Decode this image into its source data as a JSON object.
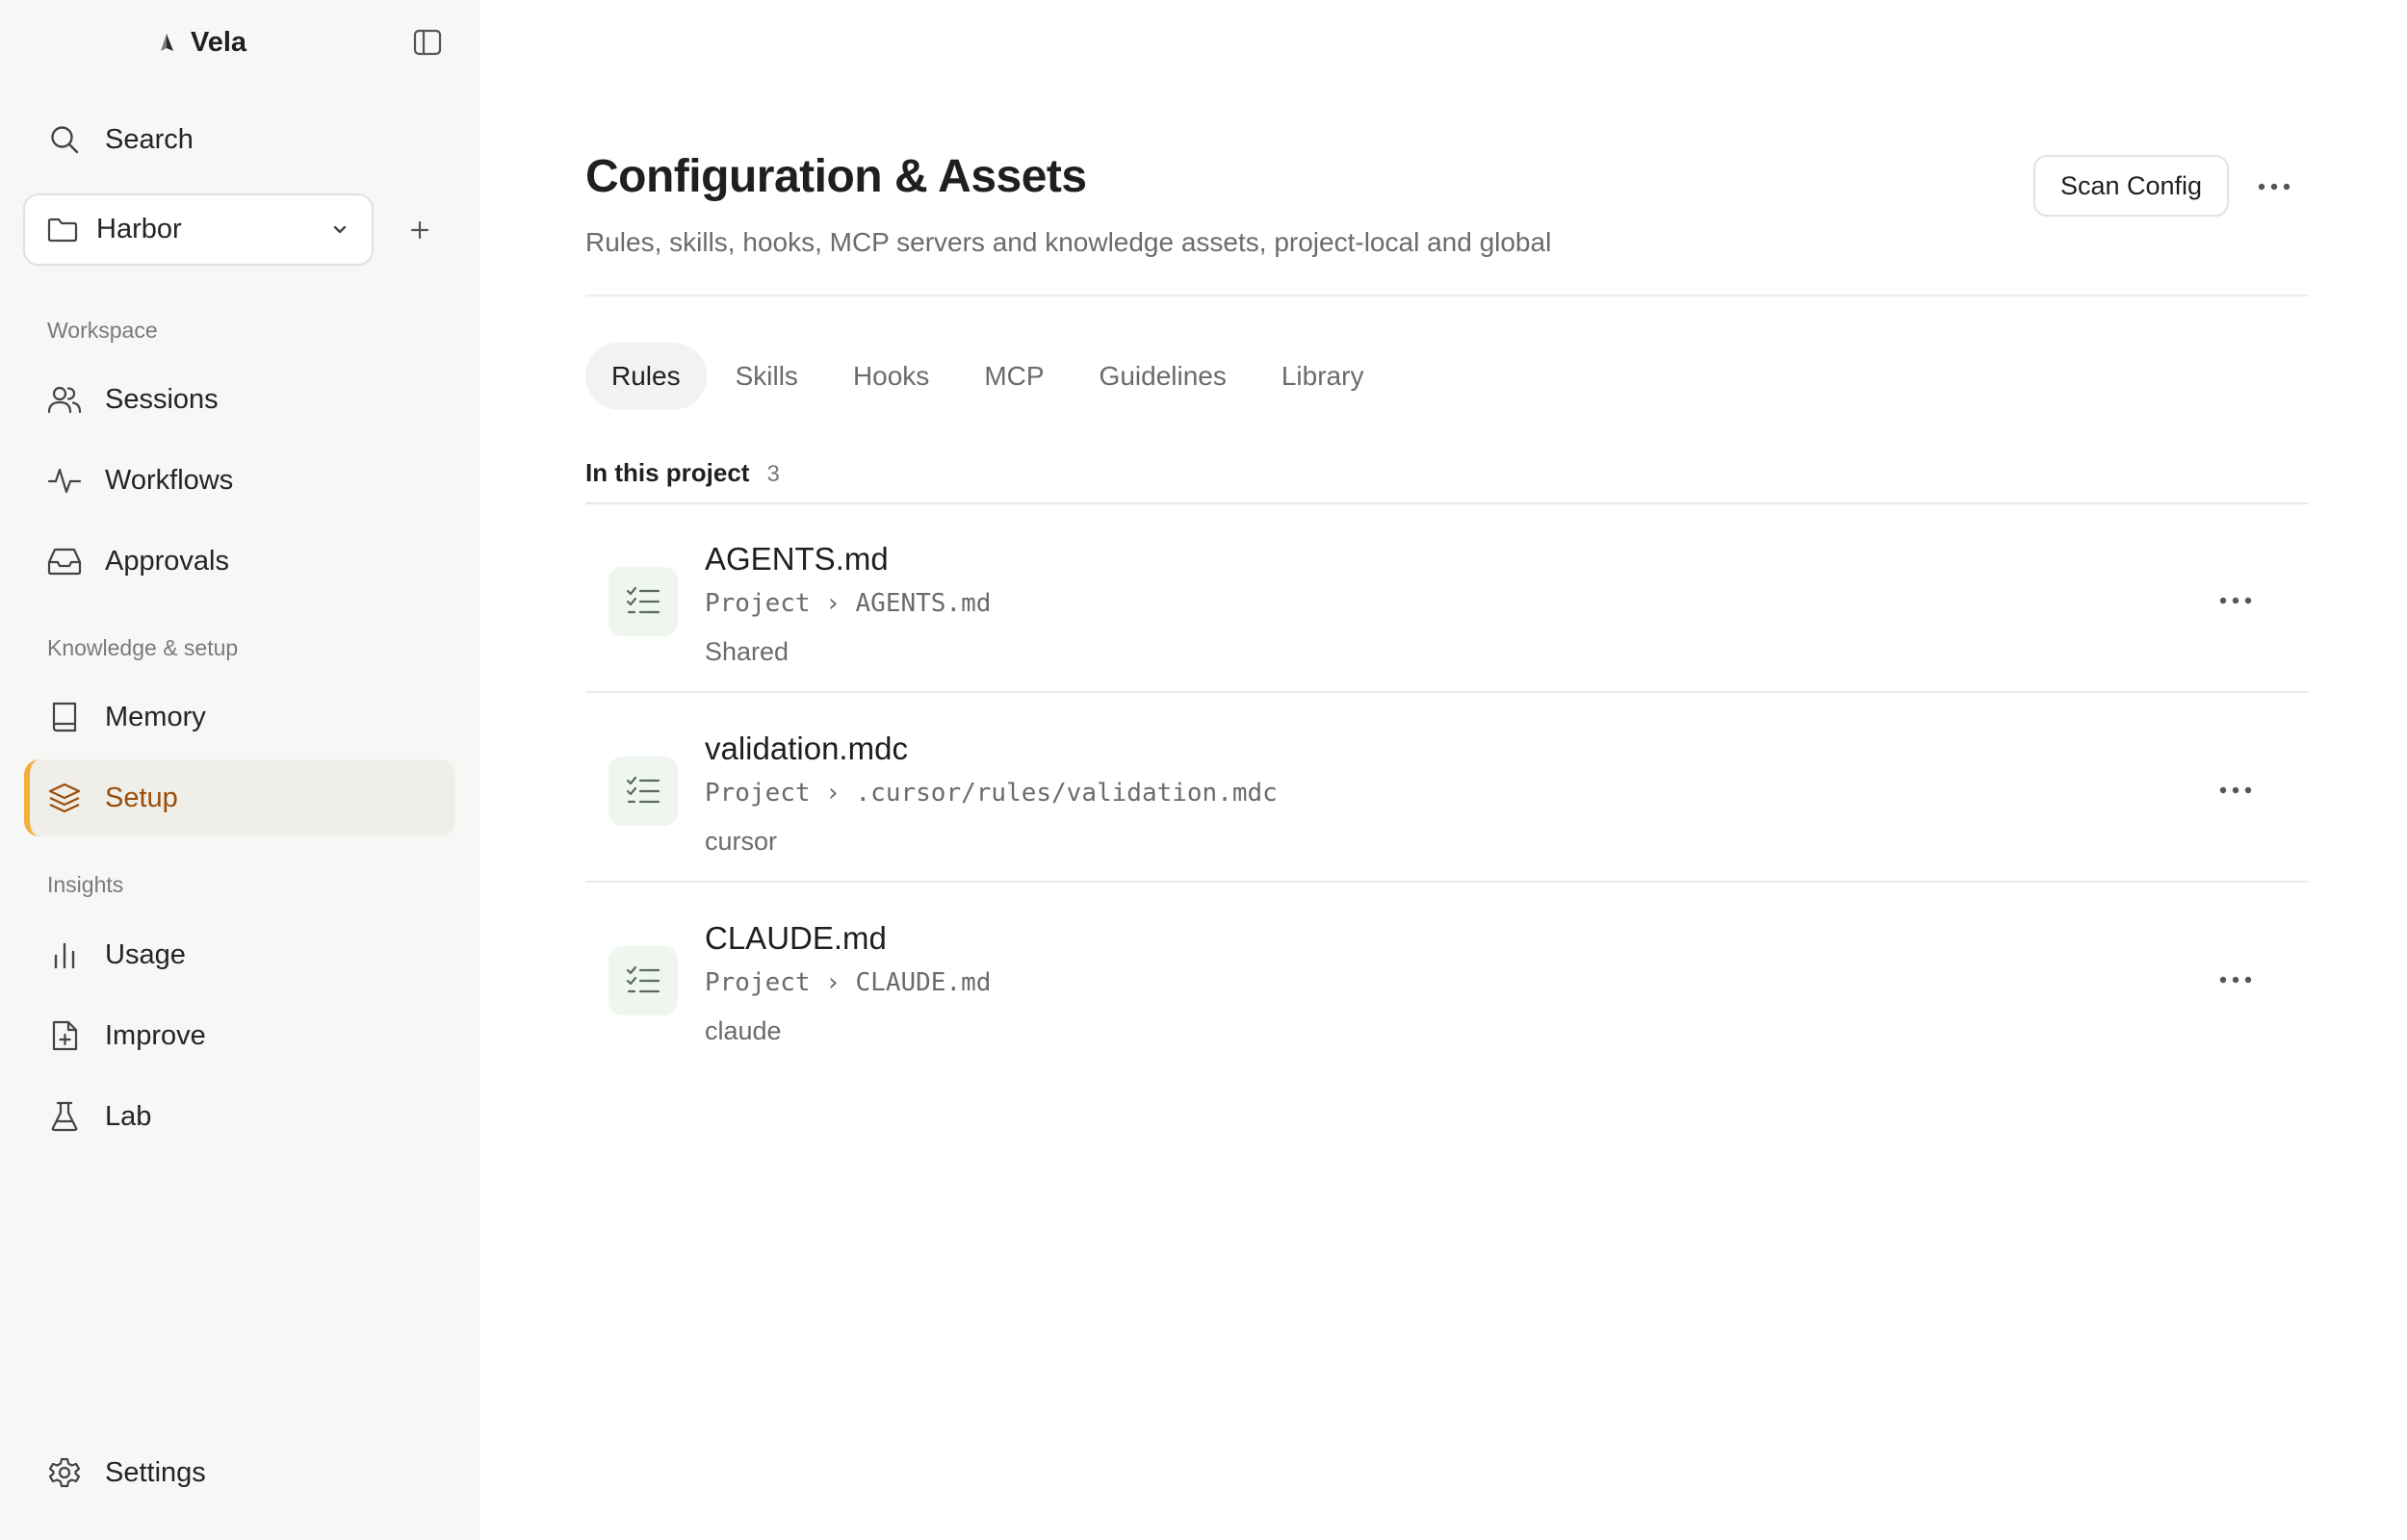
{
  "app": {
    "name": "Vela"
  },
  "sidebar": {
    "search_label": "Search",
    "project": {
      "selected": "Harbor"
    },
    "sections": {
      "workspace": "Workspace",
      "knowledge": "Knowledge & setup",
      "insights": "Insights"
    },
    "items": {
      "sessions": "Sessions",
      "workflows": "Workflows",
      "approvals": "Approvals",
      "memory": "Memory",
      "setup": "Setup",
      "usage": "Usage",
      "improve": "Improve",
      "lab": "Lab",
      "settings": "Settings"
    },
    "active_item": "setup",
    "accent_color": "#f2ae3c",
    "active_text_color": "#9a4d0a"
  },
  "header": {
    "title": "Configuration & Assets",
    "subtitle": "Rules, skills, hooks, MCP servers and knowledge assets, project-local and global",
    "scan_button": "Scan Config"
  },
  "tabs": [
    {
      "label": "Rules",
      "active": true
    },
    {
      "label": "Skills",
      "active": false
    },
    {
      "label": "Hooks",
      "active": false
    },
    {
      "label": "MCP",
      "active": false
    },
    {
      "label": "Guidelines",
      "active": false
    },
    {
      "label": "Library",
      "active": false
    }
  ],
  "section": {
    "title": "In this project",
    "count": "3"
  },
  "rules": [
    {
      "name": "AGENTS.md",
      "path": "Project › AGENTS.md",
      "tag": "Shared"
    },
    {
      "name": "validation.mdc",
      "path": "Project › .cursor/rules/validation.mdc",
      "tag": "cursor"
    },
    {
      "name": "CLAUDE.md",
      "path": "Project › CLAUDE.md",
      "tag": "claude"
    }
  ],
  "icons": {
    "brand": "sail-logo-icon",
    "collapse": "sidebar-toggle-icon",
    "search": "search-icon",
    "folder": "folder-icon",
    "chevron": "chevron-down-icon",
    "add": "plus-icon",
    "rule": "checklist-icon",
    "more": "more-horizontal-icon"
  }
}
